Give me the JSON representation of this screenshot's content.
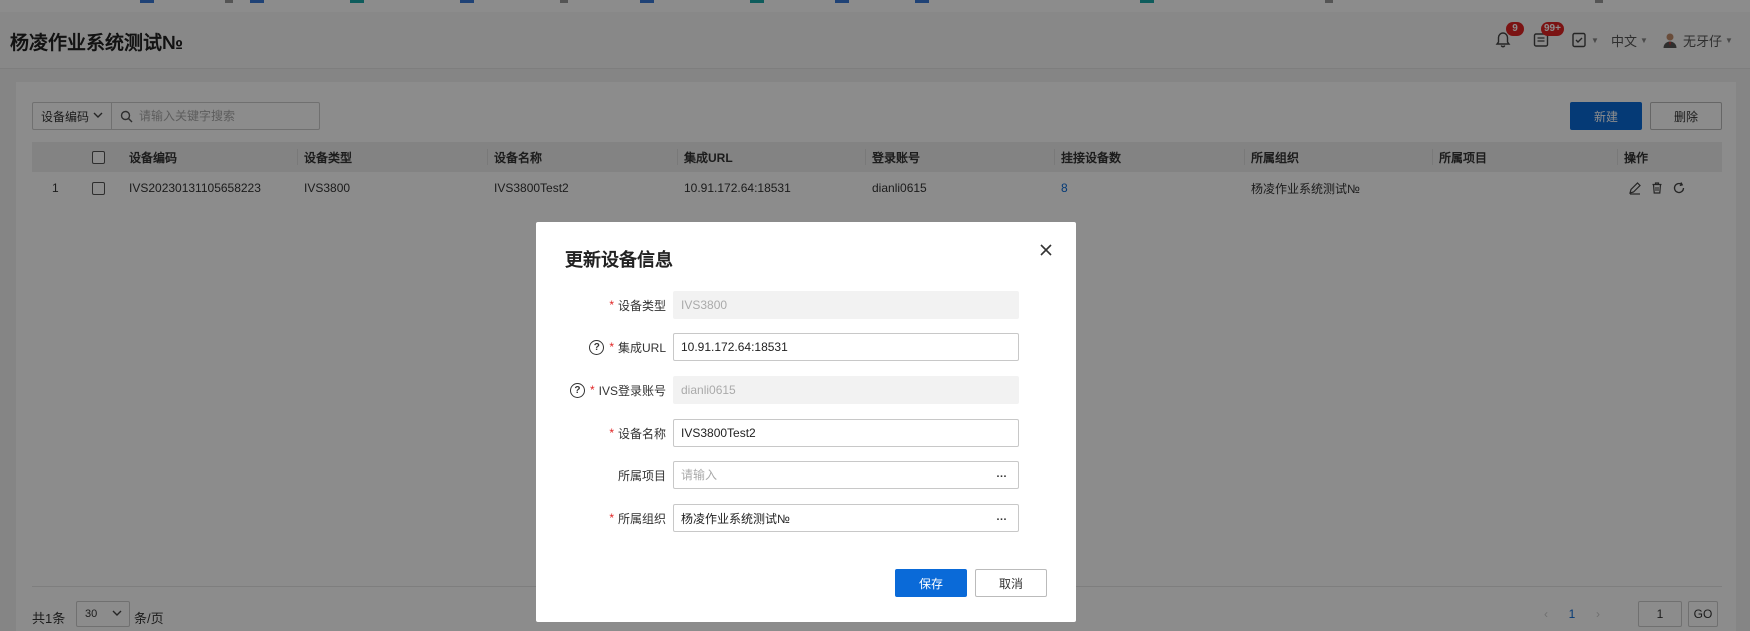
{
  "header": {
    "app_title": "杨凌作业系统测试№",
    "notification_badge": "9",
    "message_badge": "99+",
    "language": "中文",
    "user_name": "无牙仔"
  },
  "toolbar": {
    "field_select_value": "设备编码",
    "search_placeholder": "请输入关键字搜索",
    "new_button": "新建",
    "delete_button": "删除"
  },
  "table": {
    "columns": [
      "设备编码",
      "设备类型",
      "设备名称",
      "集成URL",
      "登录账号",
      "挂接设备数",
      "所属组织",
      "所属项目",
      "操作"
    ],
    "rows": [
      {
        "index": "1",
        "code": "IVS20230131105658223",
        "type": "IVS3800",
        "name": "IVS3800Test2",
        "url": "10.91.172.64:18531",
        "account": "dianli0615",
        "device_count": "8",
        "org": "杨凌作业系统测试№",
        "project": ""
      }
    ]
  },
  "footer": {
    "total_text": "共1条",
    "page_size": "30",
    "per_page_text": "条/页",
    "current_page": "1",
    "jump_value": "1",
    "go_label": "GO"
  },
  "modal": {
    "title": "更新设备信息",
    "fields": {
      "device_type": {
        "label": "设备类型",
        "value": "IVS3800"
      },
      "integration_url": {
        "label": "集成URL",
        "value": "10.91.172.64:18531"
      },
      "ivs_account": {
        "label": "IVS登录账号",
        "value": "dianli0615"
      },
      "device_name": {
        "label": "设备名称",
        "value": "IVS3800Test2"
      },
      "project": {
        "label": "所属项目",
        "placeholder": "请输入"
      },
      "organization": {
        "label": "所属组织",
        "value": "杨凌作业系统测试№"
      }
    },
    "save_button": "保存",
    "cancel_button": "取消"
  },
  "icons": {
    "more": "…",
    "help": "?"
  }
}
